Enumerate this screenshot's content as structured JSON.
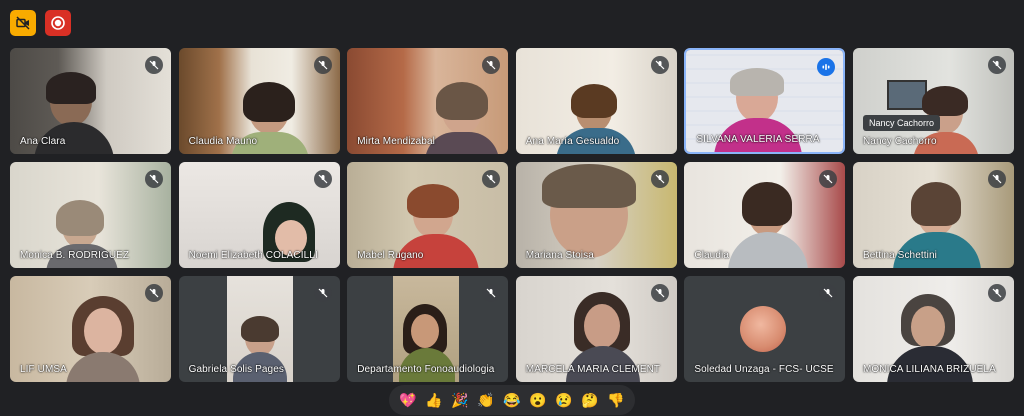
{
  "toolbar": {
    "camera_icon": "camera-off-icon",
    "record_icon": "record-icon"
  },
  "participants": [
    {
      "name": "Ana Clara",
      "muted": true
    },
    {
      "name": "Claudia Mauno",
      "muted": true
    },
    {
      "name": "Mirta Mendizabal",
      "muted": true
    },
    {
      "name": "Ana María Gesualdo",
      "muted": true
    },
    {
      "name": "SILVANA VALERIA SERRA",
      "muted": false,
      "speaking": true
    },
    {
      "name": "Nancy Cachorro",
      "muted": true,
      "tooltip": "Nancy Cachorro"
    },
    {
      "name": "Monica B. RODRIGUEZ",
      "muted": true
    },
    {
      "name": "Noemi Elizabeth COLACILLI",
      "muted": true
    },
    {
      "name": "Mabel Rugano",
      "muted": true
    },
    {
      "name": "Mariana Stoisa",
      "muted": true
    },
    {
      "name": "Claudia",
      "muted": true
    },
    {
      "name": "Bettina Schettini",
      "muted": true
    },
    {
      "name": "LIF UMSA",
      "muted": true
    },
    {
      "name": "Gabriela Solis Pages",
      "muted": true
    },
    {
      "name": "Departamento Fonoaudiologia",
      "muted": true
    },
    {
      "name": "MARCELA MARIA CLEMENT",
      "muted": true
    },
    {
      "name": "Soledad Unzaga - FCS- UCSE",
      "muted": true
    },
    {
      "name": "MONICA LILIANA BRIZUELA",
      "muted": true
    }
  ],
  "reactions": [
    "💖",
    "👍",
    "🎉",
    "👏",
    "😂",
    "😮",
    "😢",
    "🤔",
    "👎"
  ],
  "colors": {
    "background": "#202124",
    "tile": "#3c4043",
    "active_border": "#8ab4f8",
    "camera_button": "#f9ab00",
    "record_button": "#d93025"
  }
}
